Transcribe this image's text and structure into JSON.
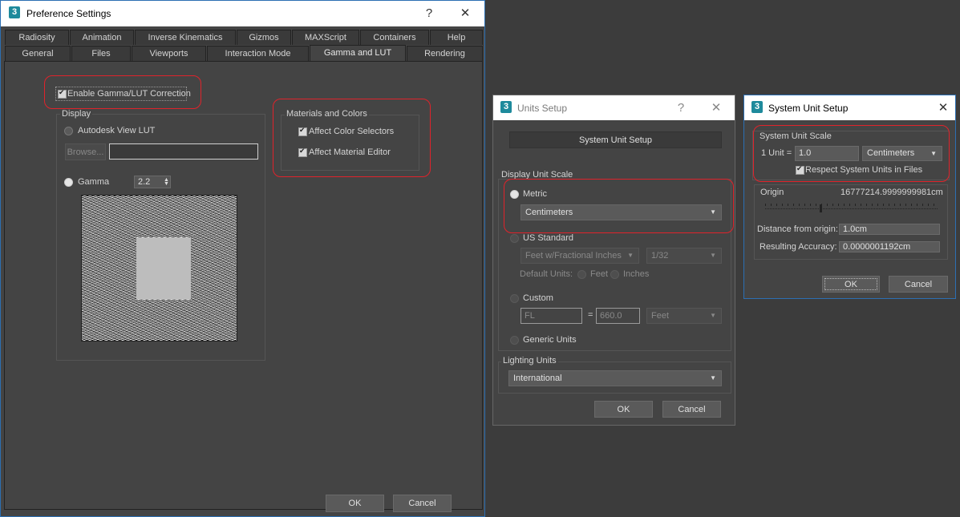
{
  "pref": {
    "title": "Preference Settings",
    "help_glyph": "?",
    "close_glyph": "✕",
    "tabs_row1": [
      "Radiosity",
      "Animation",
      "Inverse Kinematics",
      "Gizmos",
      "MAXScript",
      "Containers",
      "Help"
    ],
    "tabs_row2": [
      "General",
      "Files",
      "Viewports",
      "Interaction Mode",
      "Gamma and LUT",
      "Rendering"
    ],
    "active_tab": "Gamma and LUT",
    "enable_label": "Enable Gamma/LUT Correction",
    "display_group": "Display",
    "autodesk_lut": "Autodesk View LUT",
    "browse": "Browse...",
    "gamma_label": "Gamma",
    "gamma_value": "2.2",
    "materials_group": "Materials and Colors",
    "affect_color": "Affect Color Selectors",
    "affect_material": "Affect Material Editor",
    "ok": "OK",
    "cancel": "Cancel"
  },
  "units": {
    "title": "Units Setup",
    "help_glyph": "?",
    "close_glyph": "✕",
    "system_btn": "System Unit Setup",
    "display_group": "Display Unit Scale",
    "metric": "Metric",
    "metric_value": "Centimeters",
    "us_standard": "US Standard",
    "us_value": "Feet w/Fractional Inches",
    "fraction_value": "1/32",
    "default_units": "Default Units:",
    "feet": "Feet",
    "inches": "Inches",
    "custom": "Custom",
    "custom_name": "FL",
    "equals": "=",
    "custom_value": "660.0",
    "custom_unit": "Feet",
    "generic": "Generic Units",
    "lighting_group": "Lighting Units",
    "lighting_value": "International",
    "ok": "OK",
    "cancel": "Cancel"
  },
  "system": {
    "title": "System Unit Setup",
    "close_glyph": "✕",
    "scale_group": "System Unit Scale",
    "unit_label": "1 Unit =",
    "unit_value": "1.0",
    "unit_type": "Centimeters",
    "respect": "Respect System Units in Files",
    "origin_label": "Origin",
    "origin_value": "16777214.9999999981cm",
    "distance_label": "Distance from origin:",
    "distance_value": "1.0cm",
    "accuracy_label": "Resulting Accuracy:",
    "accuracy_value": "0.0000001192cm",
    "ok": "OK",
    "cancel": "Cancel"
  },
  "app_logo": "3",
  "colors": {
    "highlight": "#e0232b",
    "accent_border": "#2c6fb3",
    "background": "#3c3c3c"
  }
}
